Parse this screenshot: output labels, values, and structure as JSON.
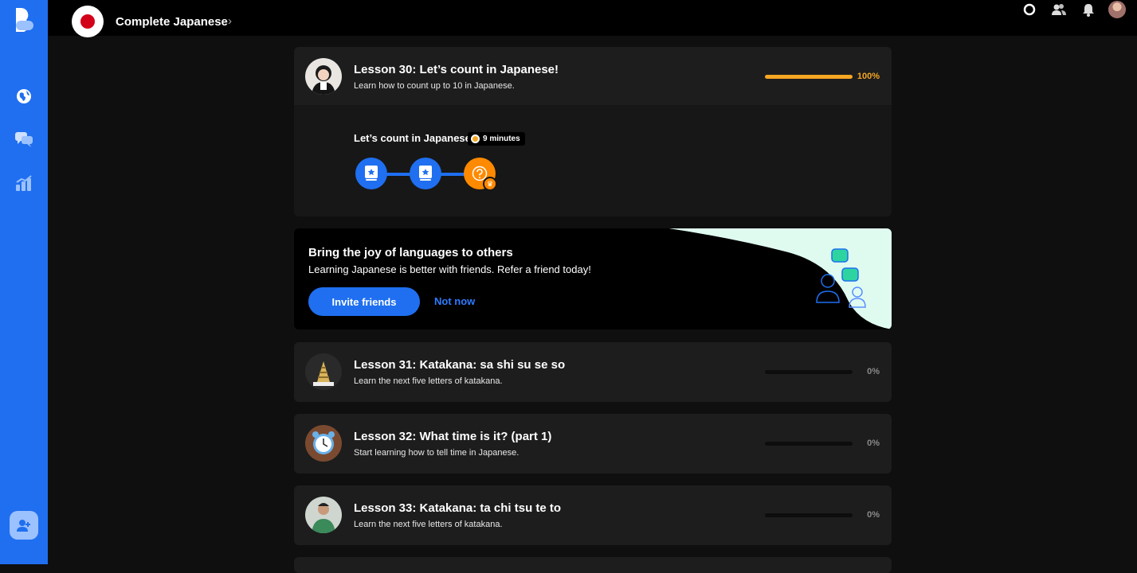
{
  "app": {
    "course_title": "Complete Japanese"
  },
  "lessons": [
    {
      "title": "Lesson 30: Let’s count in Japanese!",
      "subtitle": "Learn how to count up to 10 in Japanese.",
      "progress_label": "100%",
      "progress": 1.0,
      "activity": {
        "title": "Let’s count in Japanese!",
        "duration": "9 minutes"
      }
    },
    {
      "title": "Lesson 31: Katakana: sa shi su se so",
      "subtitle": "Learn the next five letters of katakana.",
      "progress_label": "0%",
      "progress": 0
    },
    {
      "title": "Lesson 32: What time is it? (part 1)",
      "subtitle": "Start learning how to tell time in Japanese.",
      "progress_label": "0%",
      "progress": 0
    },
    {
      "title": "Lesson 33: Katakana: ta chi tsu te to",
      "subtitle": "Learn the next five letters of katakana.",
      "progress_label": "0%",
      "progress": 0
    }
  ],
  "referral": {
    "title": "Bring the joy of languages to others",
    "subtitle": "Learning Japanese is better with friends. Refer a friend today!",
    "invite_label": "Invite friends",
    "dismiss_label": "Not now"
  },
  "icons": {
    "sidebar": [
      "globe-icon",
      "chat-icon",
      "stats-icon",
      "add-friend-icon"
    ],
    "topbar": [
      "ring-icon",
      "friends-icon",
      "bell-icon",
      "user-avatar"
    ]
  },
  "colors": {
    "brand_blue": "#1f6ff0",
    "accent_orange": "#ff8a00",
    "progress_gold": "#f5a623"
  }
}
